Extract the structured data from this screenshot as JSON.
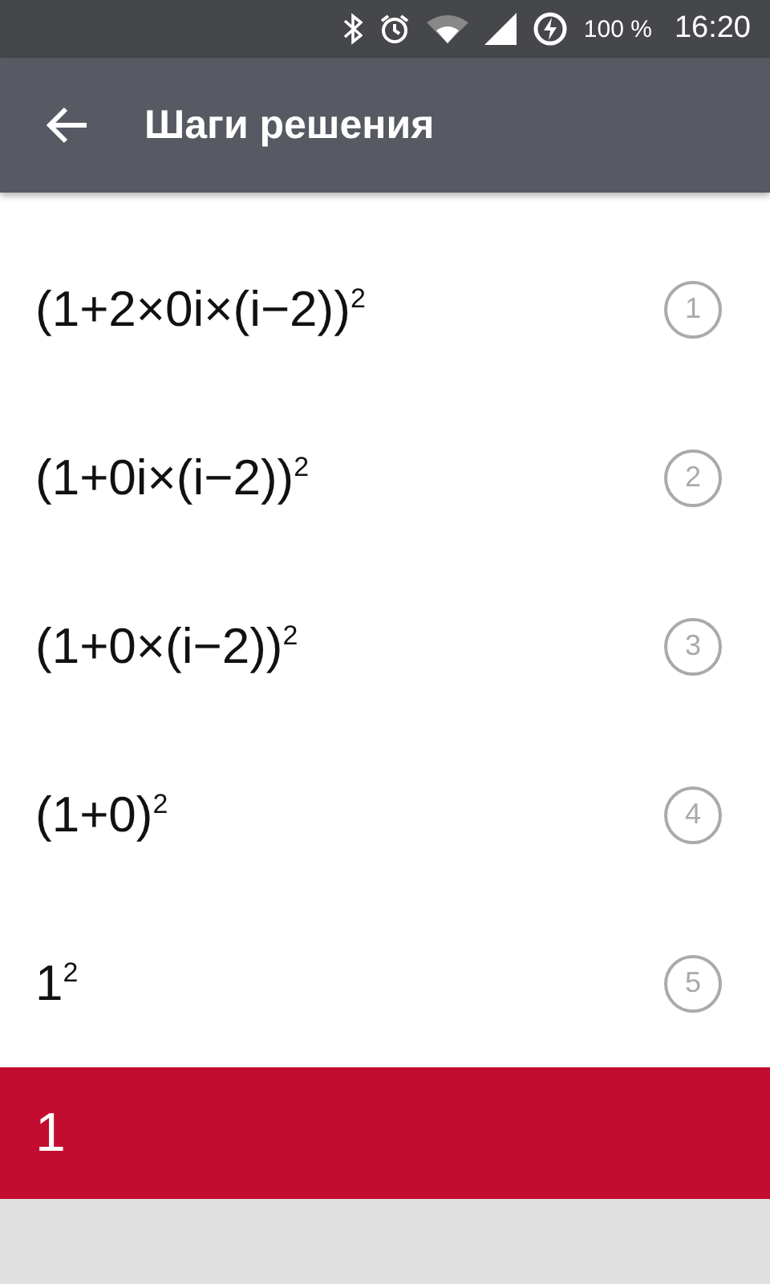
{
  "status_bar": {
    "battery": "100 %",
    "time": "16:20"
  },
  "app_bar": {
    "title": "Шаги решения"
  },
  "steps": [
    {
      "expression": "(1+2×0i×(i−2))$^{2}$",
      "number": "1"
    },
    {
      "expression": "(1+0i×(i−2))$^{2}$",
      "number": "2"
    },
    {
      "expression": "(1+0×(i−2))$^{2}$",
      "number": "3"
    },
    {
      "expression": "(1+0)$^{2}$",
      "number": "4"
    },
    {
      "expression": "1$^{2}$",
      "number": "5"
    }
  ],
  "result": {
    "value": "1"
  }
}
